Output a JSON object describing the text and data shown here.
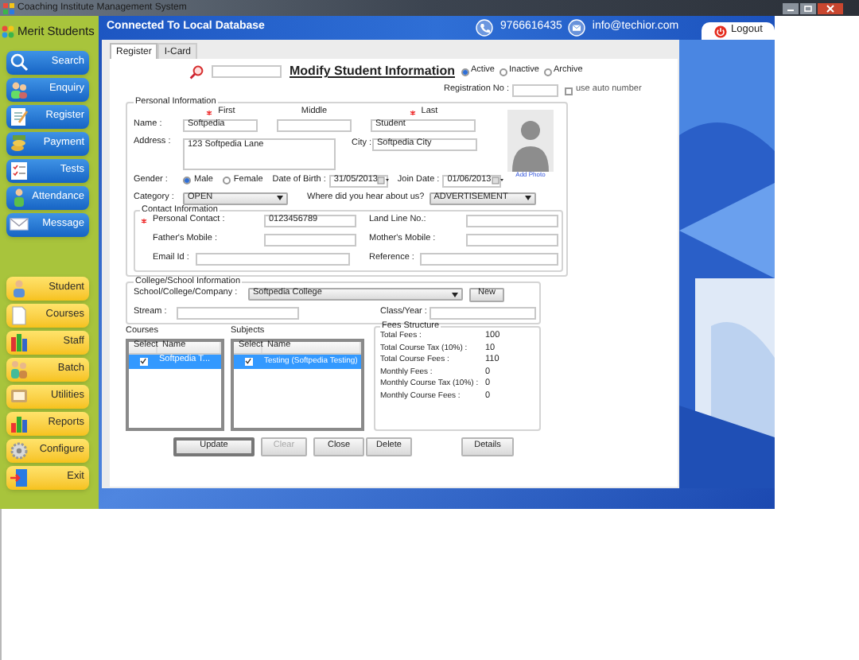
{
  "window": {
    "title": "Coaching Institute Management System"
  },
  "sidebar": {
    "logo": "Merit Students",
    "top_items": [
      {
        "label": "Search"
      },
      {
        "label": "Enquiry"
      },
      {
        "label": "Register"
      },
      {
        "label": "Payment"
      },
      {
        "label": "Tests"
      },
      {
        "label": "Attendance"
      },
      {
        "label": "Message"
      }
    ],
    "bottom_items": [
      {
        "label": "Student"
      },
      {
        "label": "Courses"
      },
      {
        "label": "Staff"
      },
      {
        "label": "Batch"
      },
      {
        "label": "Utilities"
      },
      {
        "label": "Reports"
      },
      {
        "label": "Configure"
      },
      {
        "label": "Exit"
      }
    ]
  },
  "header": {
    "connection": "Connected To  Local Database",
    "phone": "9766616435",
    "email": "info@techior.com",
    "logout": "Logout"
  },
  "tabs": [
    {
      "label": "Register",
      "selected": true
    },
    {
      "label": "I-Card",
      "selected": false
    }
  ],
  "form": {
    "title": "Modify Student Information",
    "status_options": [
      {
        "label": "Active",
        "selected": true
      },
      {
        "label": "Inactive",
        "selected": false
      },
      {
        "label": "Archive",
        "selected": false
      }
    ],
    "registration": {
      "label": "Registration No :",
      "auto_number": {
        "label": "use auto number",
        "checked": false
      }
    },
    "personal": {
      "title": "Personal Information",
      "name_label": "Name :",
      "name_fields": [
        {
          "header": "First",
          "required": true,
          "value": "Softpedia"
        },
        {
          "header": "Middle",
          "required": false
        },
        {
          "header": "Last",
          "required": true,
          "value": "Student"
        }
      ],
      "address": {
        "label": "Address :",
        "value": "123 Softpedia Lane"
      },
      "city": {
        "label": "City :",
        "value": "Softpedia City"
      },
      "photo_link": "Add Photo",
      "gender": {
        "label": "Gender :",
        "options": [
          {
            "label": "Male",
            "selected": true
          },
          {
            "label": "Female",
            "selected": false
          }
        ]
      },
      "dob": {
        "label": "Date of Birth :",
        "value": "31/05/2013"
      },
      "join_date": {
        "label": "Join Date :",
        "value": "01/06/2013"
      },
      "category": {
        "label": "Category :",
        "value": "OPEN"
      },
      "source": {
        "label": "Where did you hear about us?",
        "value": "ADVERTISEMENT"
      }
    },
    "contact": {
      "title": "Contact Information",
      "fields": [
        {
          "label": "Personal Contact :",
          "required": true,
          "value": "0123456789"
        },
        {
          "label": "Land Line No.:",
          "required": false
        },
        {
          "label": "Father's Mobile :",
          "required": false
        },
        {
          "label": "Mother's Mobile :",
          "required": false
        },
        {
          "label": "Email Id :",
          "required": false
        },
        {
          "label": "Reference :",
          "required": false
        }
      ]
    },
    "college": {
      "title": "College/School Information",
      "company": {
        "label": "School/College/Company :",
        "value": "Softpedia College"
      },
      "new_button": "New",
      "stream": {
        "label": "Stream :"
      },
      "class_year": {
        "label": "Class/Year :"
      }
    },
    "courses": {
      "title": "Courses",
      "columns": [
        "Select",
        "Name"
      ],
      "rows": [
        {
          "checked": true,
          "selected": true,
          "name": "Softpedia T..."
        }
      ]
    },
    "subjects": {
      "title": "Subjects",
      "columns": [
        "Select",
        "Name"
      ],
      "rows": [
        {
          "checked": true,
          "selected": true,
          "name": "Testing (Softpedia Testing)"
        }
      ]
    },
    "fees": {
      "title": "Fees Structure",
      "rows": [
        {
          "label": "Total Fees :",
          "value": "100"
        },
        {
          "label": "Total Course Tax (10%) :",
          "value": "10"
        },
        {
          "label": "Total Course Fees :",
          "value": "110"
        },
        {
          "label": "Monthly Fees :",
          "value": "0"
        },
        {
          "label": "Monthly Course Tax (10%) :",
          "value": "0"
        },
        {
          "label": "Monthly Course Fees :",
          "value": "0"
        }
      ]
    },
    "buttons": [
      {
        "label": "Update",
        "disabled": false
      },
      {
        "label": "Clear",
        "disabled": true
      },
      {
        "label": "Close",
        "disabled": false
      },
      {
        "label": "Delete",
        "disabled": false
      },
      {
        "label": "Details",
        "disabled": false
      }
    ]
  }
}
